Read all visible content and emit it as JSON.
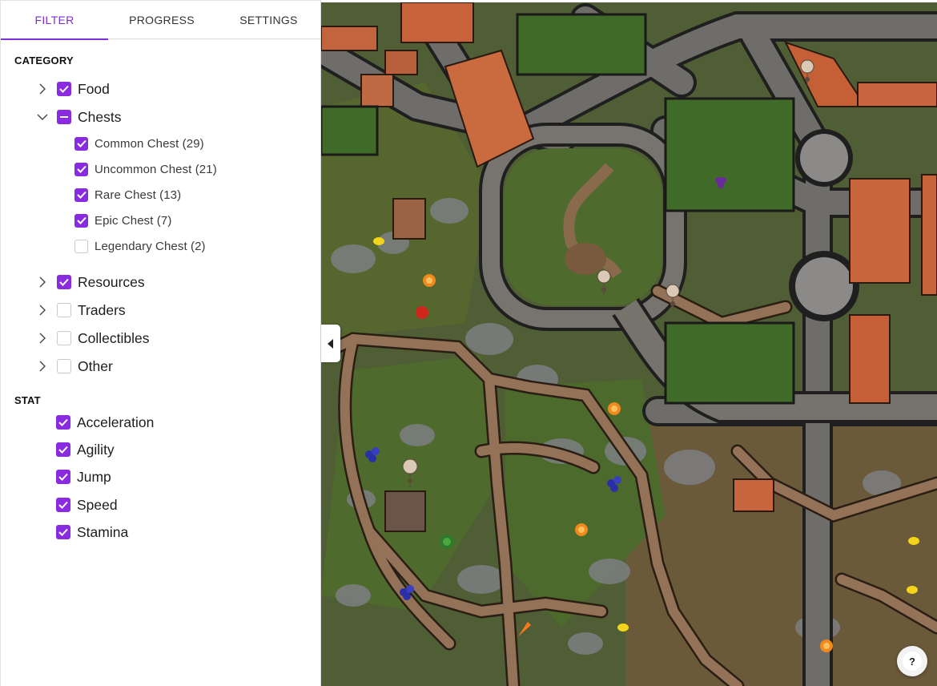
{
  "tabs": [
    {
      "label": "FILTER",
      "active": true
    },
    {
      "label": "PROGRESS",
      "active": false
    },
    {
      "label": "SETTINGS",
      "active": false
    }
  ],
  "category": {
    "title": "CATEGORY",
    "items": [
      {
        "label": "Food",
        "state": "checked",
        "expanded": false
      },
      {
        "label": "Chests",
        "state": "mixed",
        "expanded": true,
        "children": [
          {
            "label": "Common Chest (29)",
            "state": "checked"
          },
          {
            "label": "Uncommon Chest (21)",
            "state": "checked"
          },
          {
            "label": "Rare Chest (13)",
            "state": "checked"
          },
          {
            "label": "Epic Chest (7)",
            "state": "checked"
          },
          {
            "label": "Legendary Chest (2)",
            "state": "unchecked"
          }
        ]
      },
      {
        "label": "Resources",
        "state": "checked",
        "expanded": false
      },
      {
        "label": "Traders",
        "state": "unchecked",
        "expanded": false
      },
      {
        "label": "Collectibles",
        "state": "unchecked",
        "expanded": false
      },
      {
        "label": "Other",
        "state": "unchecked",
        "expanded": false
      }
    ]
  },
  "stat": {
    "title": "STAT",
    "items": [
      {
        "label": "Acceleration",
        "state": "checked"
      },
      {
        "label": "Agility",
        "state": "checked"
      },
      {
        "label": "Jump",
        "state": "checked"
      },
      {
        "label": "Speed",
        "state": "checked"
      },
      {
        "label": "Stamina",
        "state": "checked"
      }
    ]
  },
  "map": {
    "markers": [
      {
        "type": "orange"
      },
      {
        "type": "orange"
      },
      {
        "type": "orange"
      },
      {
        "type": "orange"
      },
      {
        "type": "lemon"
      },
      {
        "type": "lemon"
      },
      {
        "type": "lemon"
      },
      {
        "type": "lemon"
      },
      {
        "type": "apple"
      },
      {
        "type": "blueberry"
      },
      {
        "type": "blueberry"
      },
      {
        "type": "blueberry"
      },
      {
        "type": "watermelon"
      },
      {
        "type": "carrot"
      },
      {
        "type": "grapes"
      },
      {
        "type": "pin"
      },
      {
        "type": "pin"
      },
      {
        "type": "pin"
      },
      {
        "type": "pin"
      }
    ]
  },
  "help": {
    "label": "?"
  },
  "colors": {
    "accent": "#8a2be2",
    "tab_active": "#7b2fd6"
  }
}
